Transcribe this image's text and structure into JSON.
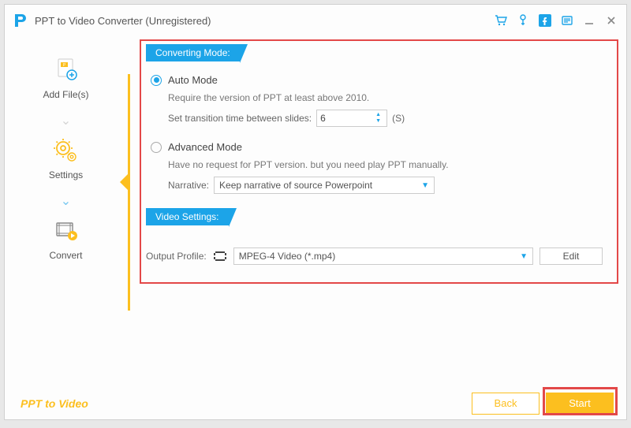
{
  "window": {
    "title": "PPT to Video Converter (Unregistered)"
  },
  "sidebar": {
    "items": [
      {
        "label": "Add File(s)"
      },
      {
        "label": "Settings"
      },
      {
        "label": "Convert"
      }
    ]
  },
  "sections": {
    "converting_mode": "Converting Mode:",
    "video_settings": "Video Settings:"
  },
  "auto_mode": {
    "label": "Auto Mode",
    "desc": "Require the version of PPT at least above 2010.",
    "transition_label": "Set transition time between slides:",
    "transition_value": "6",
    "unit": "(S)"
  },
  "advanced_mode": {
    "label": "Advanced Mode",
    "desc": "Have no request for PPT version. but you need play PPT manually.",
    "narrative_label": "Narrative:",
    "narrative_value": "Keep narrative of source Powerpoint"
  },
  "output": {
    "label": "Output Profile:",
    "value": "MPEG-4 Video (*.mp4)",
    "edit": "Edit"
  },
  "footer": {
    "brand": "PPT to Video",
    "back": "Back",
    "start": "Start"
  }
}
